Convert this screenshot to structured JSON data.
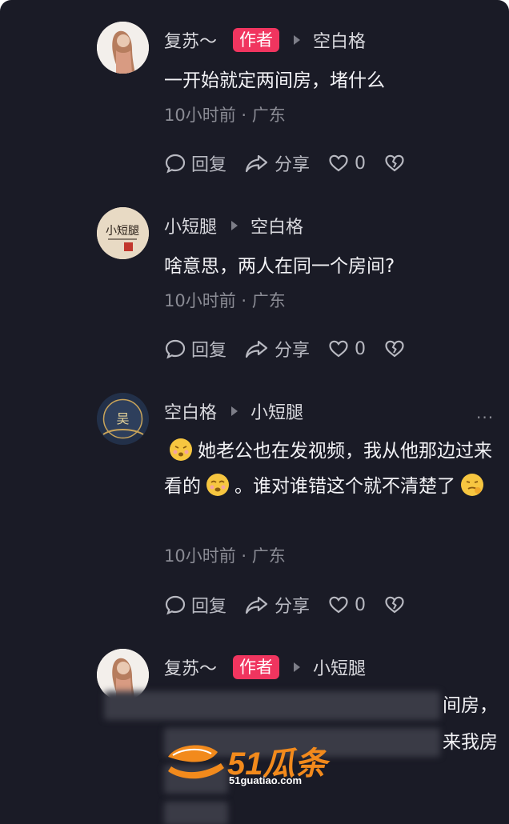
{
  "comments": [
    {
      "name": "复苏～",
      "badge": "作者",
      "reply_to": "空白格",
      "text": "一开始就定两间房，堵什么",
      "meta": "10小时前 · 广东",
      "reply_label": "回复",
      "share_label": "分享",
      "likes": "0"
    },
    {
      "name": "小短腿",
      "reply_to": "空白格",
      "text": "啥意思，两人在同一个房间?",
      "meta": "10小时前 · 广东",
      "reply_label": "回复",
      "share_label": "分享",
      "likes": "0"
    },
    {
      "name": "空白格",
      "reply_to": "小短腿",
      "more": "···",
      "text_parts": [
        "她老公也在发视频，我从他那边过来看的",
        "。谁对谁错这个就不清楚了"
      ],
      "meta": "10小时前 · 广东",
      "reply_label": "回复",
      "share_label": "分享",
      "likes": "0"
    },
    {
      "name": "复苏～",
      "badge": "作者",
      "reply_to": "小短腿",
      "visible_fragments": [
        "间房，",
        "来我房"
      ]
    }
  ],
  "watermark": {
    "text": "51瓜条",
    "url": "51guatiao.com"
  },
  "colors": {
    "background": "#1a1b26",
    "author_badge": "#f0355f",
    "watermark": "#f28a1c"
  },
  "icons": [
    "comment-icon",
    "share-icon",
    "heart-icon",
    "broken-heart-icon",
    "more-icon"
  ]
}
